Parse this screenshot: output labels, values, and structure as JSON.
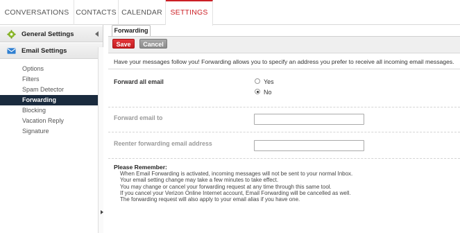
{
  "nav": {
    "tabs": [
      {
        "label": "CONVERSATIONS"
      },
      {
        "label": "CONTACTS"
      },
      {
        "label": "CALENDAR"
      },
      {
        "label": "SETTINGS"
      }
    ],
    "active": "SETTINGS"
  },
  "sidebar": {
    "general_settings": "General Settings",
    "email_settings": "Email Settings",
    "items": [
      {
        "label": "Options"
      },
      {
        "label": "Filters"
      },
      {
        "label": "Spam Detector"
      },
      {
        "label": "Forwarding"
      },
      {
        "label": "Blocking"
      },
      {
        "label": "Vacation Reply"
      },
      {
        "label": "Signature"
      }
    ],
    "active_item": "Forwarding"
  },
  "panel": {
    "tab_label": "Forwarding",
    "save_label": "Save",
    "cancel_label": "Cancel",
    "intro": "Have your messages follow you! Forwarding allows you to specify an address you prefer to receive all incoming email messages.",
    "forward_all_label": "Forward all email",
    "option_yes": "Yes",
    "option_no": "No",
    "selected_option": "No",
    "forward_to_label": "Forward email to",
    "forward_to_value": "",
    "reenter_label": "Reenter forwarding email address",
    "reenter_value": "",
    "remember_title": "Please Remember:",
    "remember_lines": [
      "When Email Forwarding is activated, incoming messages will not be sent to your normal Inbox.",
      "Your email setting change may take a few minutes to take effect.",
      "You may change or cancel your forwarding request at any time through this same tool.",
      "If you cancel your Verizon Online Internet account, Email Forwarding will be cancelled as well.",
      "The forwarding request will also apply to your email alias if you have one."
    ]
  },
  "colors": {
    "accent": "#cc1f25",
    "sidebar_active": "#1a2b3e"
  }
}
